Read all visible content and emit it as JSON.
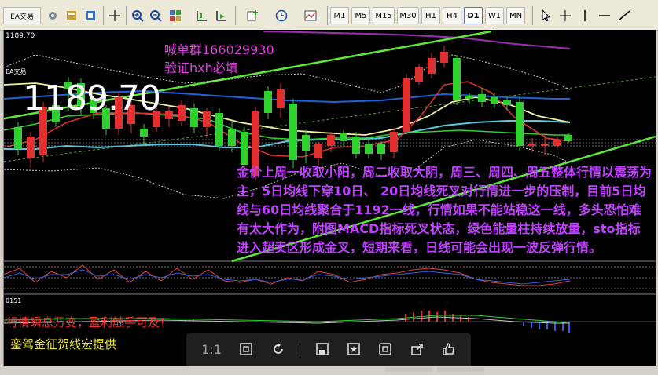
{
  "toolbar": {
    "timeframes": [
      "M1",
      "M5",
      "M15",
      "M30",
      "H1",
      "H4",
      "D1",
      "W1",
      "MN"
    ],
    "active_timeframe": "D1"
  },
  "chart": {
    "price_label": "1189.70",
    "price_big": "1189.70",
    "ea_label": "EA交易",
    "watermark_line1": "喊单群166029930",
    "watermark_line2": "验证hxh必填",
    "analysis_text": "金价上周一收取小阳，周二收取大阴，周三、周四、周五整体行情以震荡为主，5日均线下穿10日、 20日均线死叉对行情进一步的压制，目前5日均线与60日均线聚合于1192一线，行情如果不能站稳这一线，多头恐怕难有太大作为，附图MACD指标死叉状态，绿色能量柱持续放量，sto指标进入超卖区形成金叉，短期来看，日线可能会出现一波反弹行情。",
    "sub_label": "0151",
    "red_text": "行情瞬息万变，盈利触手可及！",
    "yellow_text": "銮驾金征贺线宏提供"
  },
  "viewer": {
    "page_label": "1:1"
  }
}
